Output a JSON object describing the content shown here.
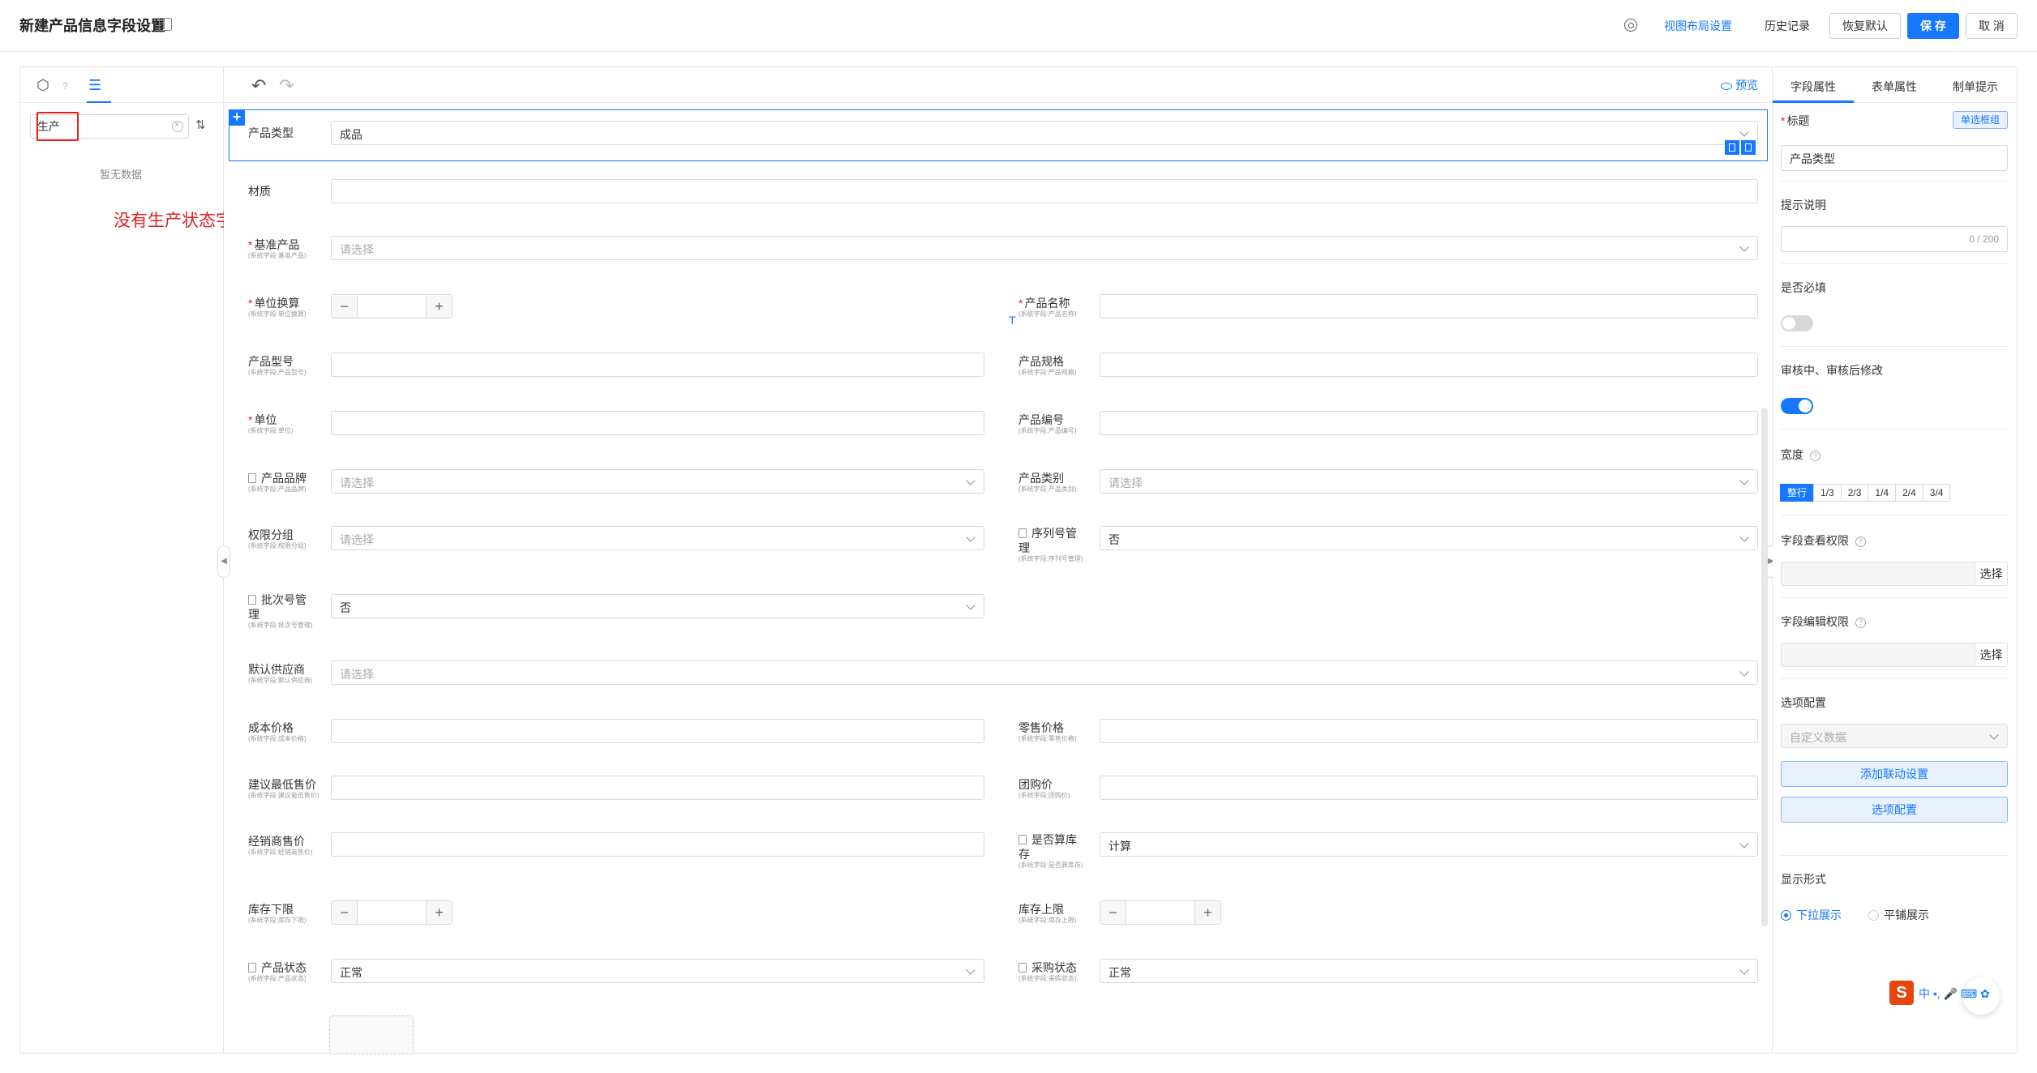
{
  "header": {
    "title": "新建产品信息字段设置",
    "layout_link": "视图布局设置",
    "history_link": "历史记录",
    "restore_label": "恢复默认",
    "save_label": "保 存",
    "cancel_label": "取 消"
  },
  "left_panel": {
    "search_value": "生产",
    "empty_text": "暂无数据",
    "annotation": "没有生产状态字段"
  },
  "toolbar": {
    "preview_label": "预览"
  },
  "fields": {
    "product_type": {
      "label": "产品类型",
      "value": "成品"
    },
    "material": {
      "label": "材质"
    },
    "base_product": {
      "label": "基准产品",
      "sub": "(系统字段:基准产品)",
      "placeholder": "请选择"
    },
    "unit_conv": {
      "label": "单位换算",
      "sub": "(系统字段:单位换算)"
    },
    "product_name": {
      "label": "产品名称",
      "sub": "(系统字段:产品名称)"
    },
    "product_model": {
      "label": "产品型号",
      "sub": "(系统字段:产品型号)"
    },
    "product_spec": {
      "label": "产品规格",
      "sub": "(系统字段:产品规格)"
    },
    "unit": {
      "label": "单位",
      "sub": "(系统字段:单位)"
    },
    "product_code": {
      "label": "产品编号",
      "sub": "(系统字段:产品编号)"
    },
    "brand": {
      "label": "产品品牌",
      "sub": "(系统字段:产品品牌)",
      "placeholder": "请选择"
    },
    "category": {
      "label": "产品类别",
      "sub": "(系统字段:产品类别)",
      "placeholder": "请选择"
    },
    "perm_group": {
      "label": "权限分组",
      "sub": "(系统字段:权限分组)",
      "placeholder": "请选择"
    },
    "serial_mgmt": {
      "label1": "序列号管",
      "label2": "理",
      "sub": "(系统字段:序列号管理)",
      "value": "否"
    },
    "batch_mgmt": {
      "label1": "批次号管",
      "label2": "理",
      "sub": "(系统字段:批次号管理)",
      "value": "否"
    },
    "supplier": {
      "label": "默认供应商",
      "sub": "(系统字段:默认供应商)",
      "placeholder": "请选择"
    },
    "cost_price": {
      "label": "成本价格",
      "sub": "(系统字段:成本价格)"
    },
    "retail_price": {
      "label": "零售价格",
      "sub": "(系统字段:零售价格)"
    },
    "min_price": {
      "label": "建议最低售价",
      "sub": "(系统字段:建议最低售价)"
    },
    "group_price": {
      "label": "团购价",
      "sub": "(系统字段:团购价)"
    },
    "dealer_price": {
      "label": "经销商售价",
      "sub": "(系统字段:经销商售价)"
    },
    "calc_stock": {
      "label1": "是否算库",
      "label2": "存",
      "sub": "(系统字段:是否算库存)",
      "value": "计算"
    },
    "stock_min": {
      "label": "库存下限",
      "sub": "(系统字段:库存下限)"
    },
    "stock_max": {
      "label": "库存上限",
      "sub": "(系统字段:库存上限)"
    },
    "product_status": {
      "label": "产品状态",
      "sub": "(系统字段:产品状态)",
      "value": "正常"
    },
    "purchase_status": {
      "label": "采购状态",
      "sub": "(系统字段:采购状态)",
      "value": "正常"
    }
  },
  "right_panel": {
    "tabs": [
      "字段属性",
      "表单属性",
      "制单提示"
    ],
    "title_label": "标题",
    "radio_button_label": "单选框组",
    "title_value": "产品类型",
    "hint_label": "提示说明",
    "hint_counter": "0 / 200",
    "required_label": "是否必填",
    "required_on": false,
    "edit_label": "审核中、审核后修改",
    "edit_on": true,
    "width_label": "宽度",
    "width_options": [
      "整行",
      "1/3",
      "2/3",
      "1/4",
      "2/4",
      "3/4"
    ],
    "view_perm_label": "字段查看权限",
    "edit_perm_label": "字段编辑权限",
    "select_label": "选择",
    "options_label": "选项配置",
    "custom_data": "自定义数据",
    "add_link_button": "添加联动设置",
    "options_button": "选项配置",
    "display_label": "显示形式",
    "display_options": [
      "下拉展示",
      "平铺展示"
    ],
    "display_selected": "下拉展示"
  },
  "ime": {
    "label": "中"
  },
  "colors": {
    "primary": "#1677ff",
    "annotation": "#e02020"
  }
}
